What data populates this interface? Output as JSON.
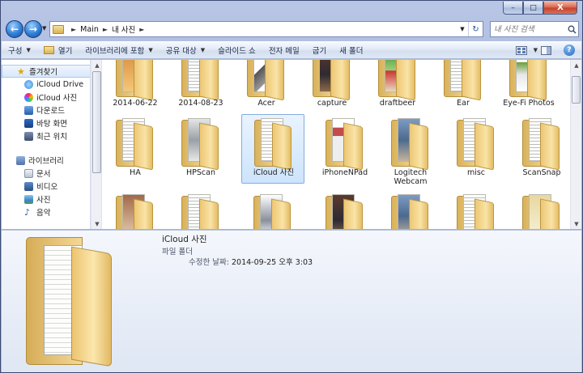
{
  "window": {
    "caption": {
      "minimize": "–",
      "maximize": "□",
      "close": "X"
    }
  },
  "address": {
    "crumbs": [
      "Main",
      "내 사진"
    ],
    "search_placeholder": "내 사진 검색"
  },
  "toolbar": {
    "organize": "구성",
    "open": "열기",
    "add_to_library": "라이브러리에 포함",
    "share_with": "공유 대상",
    "slideshow": "슬라이드 쇼",
    "email": "전자 메일",
    "burn": "굽기",
    "new_folder": "새 폴더",
    "help": "?"
  },
  "navpane": {
    "favorites": {
      "header": "즐겨찾기",
      "items": [
        "iCloud Drive",
        "iCloud 사진",
        "다운로드",
        "바탕 화면",
        "최근 위치"
      ]
    },
    "libraries": {
      "header": "라이브러리",
      "items": [
        "문서",
        "비디오",
        "사진",
        "음악"
      ]
    }
  },
  "folders": {
    "row1": [
      "2014-06-22",
      "2014-08-23",
      "Acer",
      "capture",
      "draftbeer",
      "Ear",
      "Eye-Fi Photos"
    ],
    "row2": [
      "HA",
      "HPScan",
      "iCloud 사진",
      "iPhoneNPad",
      "Logitech Webcam",
      "misc",
      "ScanSnap"
    ],
    "selected": "iCloud 사진"
  },
  "details": {
    "name": "iCloud 사진",
    "type": "파일 폴더",
    "modified_label": "수정한 날짜:",
    "modified_value": "2014-09-25 오후 3:03"
  },
  "colors": {
    "frame": "#a9bbdf",
    "selection": "#cde4fc",
    "folder": "#f2d68f"
  }
}
